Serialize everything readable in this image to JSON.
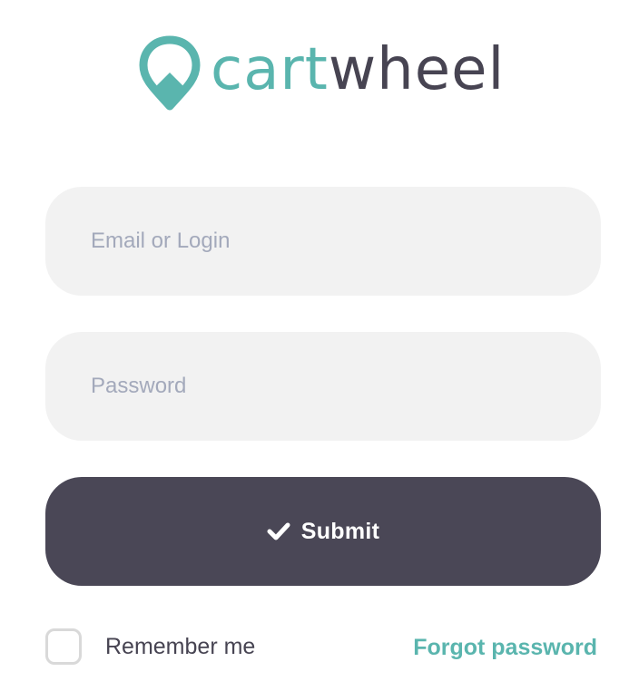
{
  "brand": {
    "name_part1": "cart",
    "name_part2": "wheel",
    "logo_icon": "location-pin-icon",
    "primary_color": "#5ab5ae",
    "dark_color": "#474452"
  },
  "form": {
    "email_placeholder": "Email or Login",
    "email_value": "",
    "password_placeholder": "Password",
    "password_value": "",
    "submit_label": "Submit",
    "submit_icon": "check-icon",
    "submit_color": "#4a4756",
    "remember_label": "Remember me",
    "remember_checked": false,
    "forgot_label": "Forgot password"
  }
}
